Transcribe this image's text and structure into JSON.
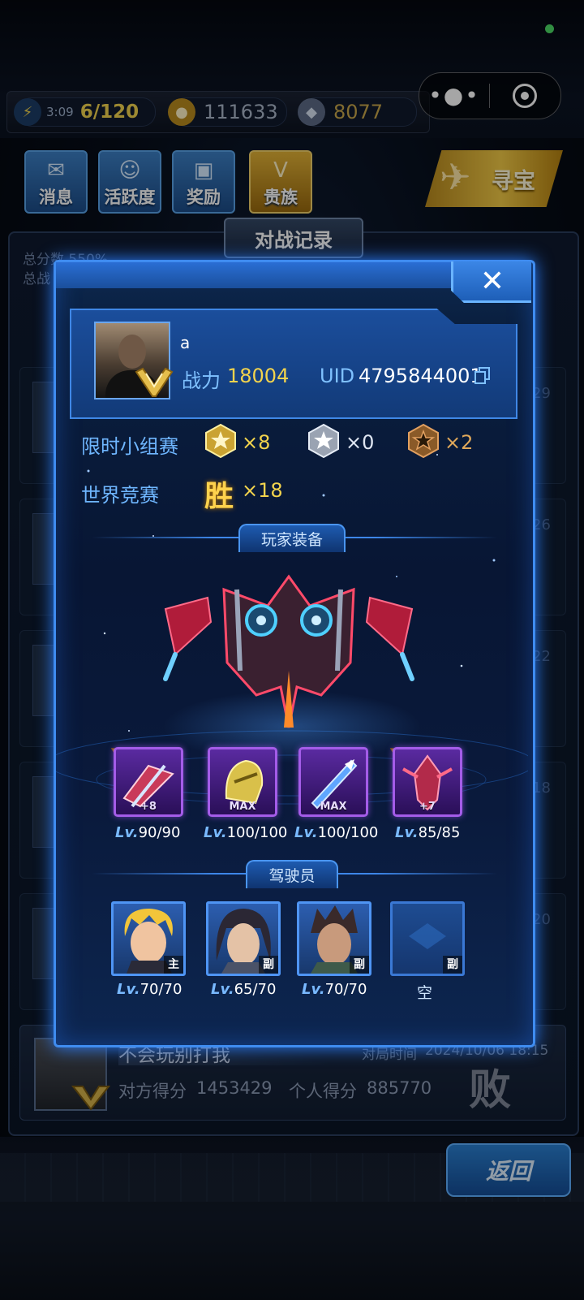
{
  "resources": {
    "energy_timer": "3:09",
    "energy_count": "6/120",
    "coins": "111633",
    "gems": "8077"
  },
  "menu": {
    "messages": "消息",
    "activity": "活跃度",
    "rewards": "奖励",
    "noble": "贵族",
    "treasure": "寻宝"
  },
  "background": {
    "panel_title": "对战记录",
    "summary_line1": "总分数  550%",
    "summary_line2": "总战",
    "ghost_numbers": [
      "29",
      "26",
      "22",
      "18",
      "20"
    ]
  },
  "match": {
    "player_name": "不会玩别打我",
    "time_label": "对局时间",
    "time_value": "2024/10/06 18:15",
    "opponent_score_label": "对方得分",
    "opponent_score": "1453429",
    "self_score_label": "个人得分",
    "self_score": "885770",
    "result": "败"
  },
  "back_button": "返回",
  "modal": {
    "close": "✕",
    "player": {
      "name": "a",
      "power_label": "战力",
      "power_value": "18004",
      "uid_label": "UID",
      "uid_value": "4795844001"
    },
    "limited_group": {
      "label": "限时小组赛",
      "gold_count": "×8",
      "silver_count": "×0",
      "bronze_count": "×2"
    },
    "world": {
      "label": "世界竞赛",
      "win_char": "胜",
      "win_count": "×18"
    },
    "equipment_title": "玩家装备",
    "equipment": [
      {
        "tag": "+8",
        "lv_prefix": "Lv.",
        "level": "90/90"
      },
      {
        "tag": "MAX",
        "lv_prefix": "Lv.",
        "level": "100/100"
      },
      {
        "tag": "MAX",
        "lv_prefix": "Lv.",
        "level": "100/100"
      },
      {
        "tag": "+7",
        "lv_prefix": "Lv.",
        "level": "85/85"
      }
    ],
    "pilots_title": "驾驶员",
    "pilots": [
      {
        "tag": "主",
        "lv_prefix": "Lv.",
        "level": "70/70"
      },
      {
        "tag": "副",
        "lv_prefix": "Lv.",
        "level": "65/70"
      },
      {
        "tag": "副",
        "lv_prefix": "Lv.",
        "level": "70/70"
      },
      {
        "tag": "副",
        "empty_label": "空"
      }
    ]
  }
}
